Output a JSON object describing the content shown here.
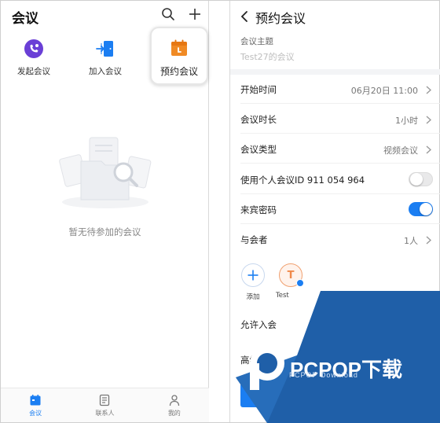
{
  "left": {
    "title": "会议",
    "actions": [
      {
        "label": "发起会议",
        "icon": "phone-video-icon"
      },
      {
        "label": "加入会议",
        "icon": "join-door-icon"
      },
      {
        "label": "预约会议",
        "icon": "calendar-icon"
      }
    ],
    "empty_text": "暂无待参加的会议",
    "tabs": [
      {
        "label": "会议",
        "icon": "calendar-icon",
        "active": true
      },
      {
        "label": "联系人",
        "icon": "contacts-icon",
        "active": false
      },
      {
        "label": "我的",
        "icon": "person-icon",
        "active": false
      }
    ]
  },
  "right": {
    "title": "预约会议",
    "topic_label": "会议主题",
    "topic_value": "Test27的会议",
    "rows": [
      {
        "label": "开始时间",
        "value": "06月20日 11:00"
      },
      {
        "label": "会议时长",
        "value": "1小时"
      },
      {
        "label": "会议类型",
        "value": "视频会议"
      },
      {
        "label": "使用个人会议ID 911 054 964",
        "toggle": false
      },
      {
        "label": "来宾密码",
        "toggle": true
      },
      {
        "label": "与会者",
        "value": "1人"
      }
    ],
    "add_label": "添加",
    "user_initial": "T",
    "user_label": "Test",
    "allow_join_label": "允许入会",
    "advanced_label": "高级设置",
    "submit_label": "预约会议"
  },
  "watermark": {
    "brand": "PCPOP下载",
    "sub": "PCPOP Download"
  },
  "colors": {
    "accent": "#1b7ef2",
    "purple": "#6a3fd6",
    "orange": "#f08a24",
    "watermark_blue": "#1f5fa8"
  }
}
